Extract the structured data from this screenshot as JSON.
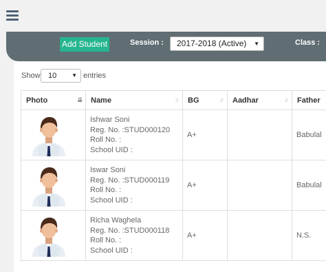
{
  "toolbar": {
    "add_label": "Add Student",
    "session_label": "Session :",
    "session_value": "2017-2018 (Active)",
    "class_label": "Class :"
  },
  "table_controls": {
    "show_label": "Show",
    "entries_value": "10",
    "entries_label": "entries"
  },
  "columns": [
    "Photo",
    "Name",
    "BG",
    "Aadhar",
    "Father"
  ],
  "rows": [
    {
      "name": "Ishwar Soni",
      "reg": "Reg. No. :STUD000120",
      "roll": "Roll No. :",
      "uid": "School UID :",
      "bg": "A+",
      "aadhar": "",
      "father": "Babulal"
    },
    {
      "name": "Iswar Soni",
      "reg": "Reg. No. :STUD000119",
      "roll": "Roll No. :",
      "uid": "School UID :",
      "bg": "A+",
      "aadhar": "",
      "father": "Babulal"
    },
    {
      "name": "Richa Waghela",
      "reg": "Reg. No. :STUD000118",
      "roll": "Roll No. :",
      "uid": "School UID :",
      "bg": "A+",
      "aadhar": "",
      "father": "N.S."
    }
  ],
  "colors": {
    "accent": "#26b68f",
    "toolbar": "#606d72",
    "menu_icon": "#4d6278"
  }
}
